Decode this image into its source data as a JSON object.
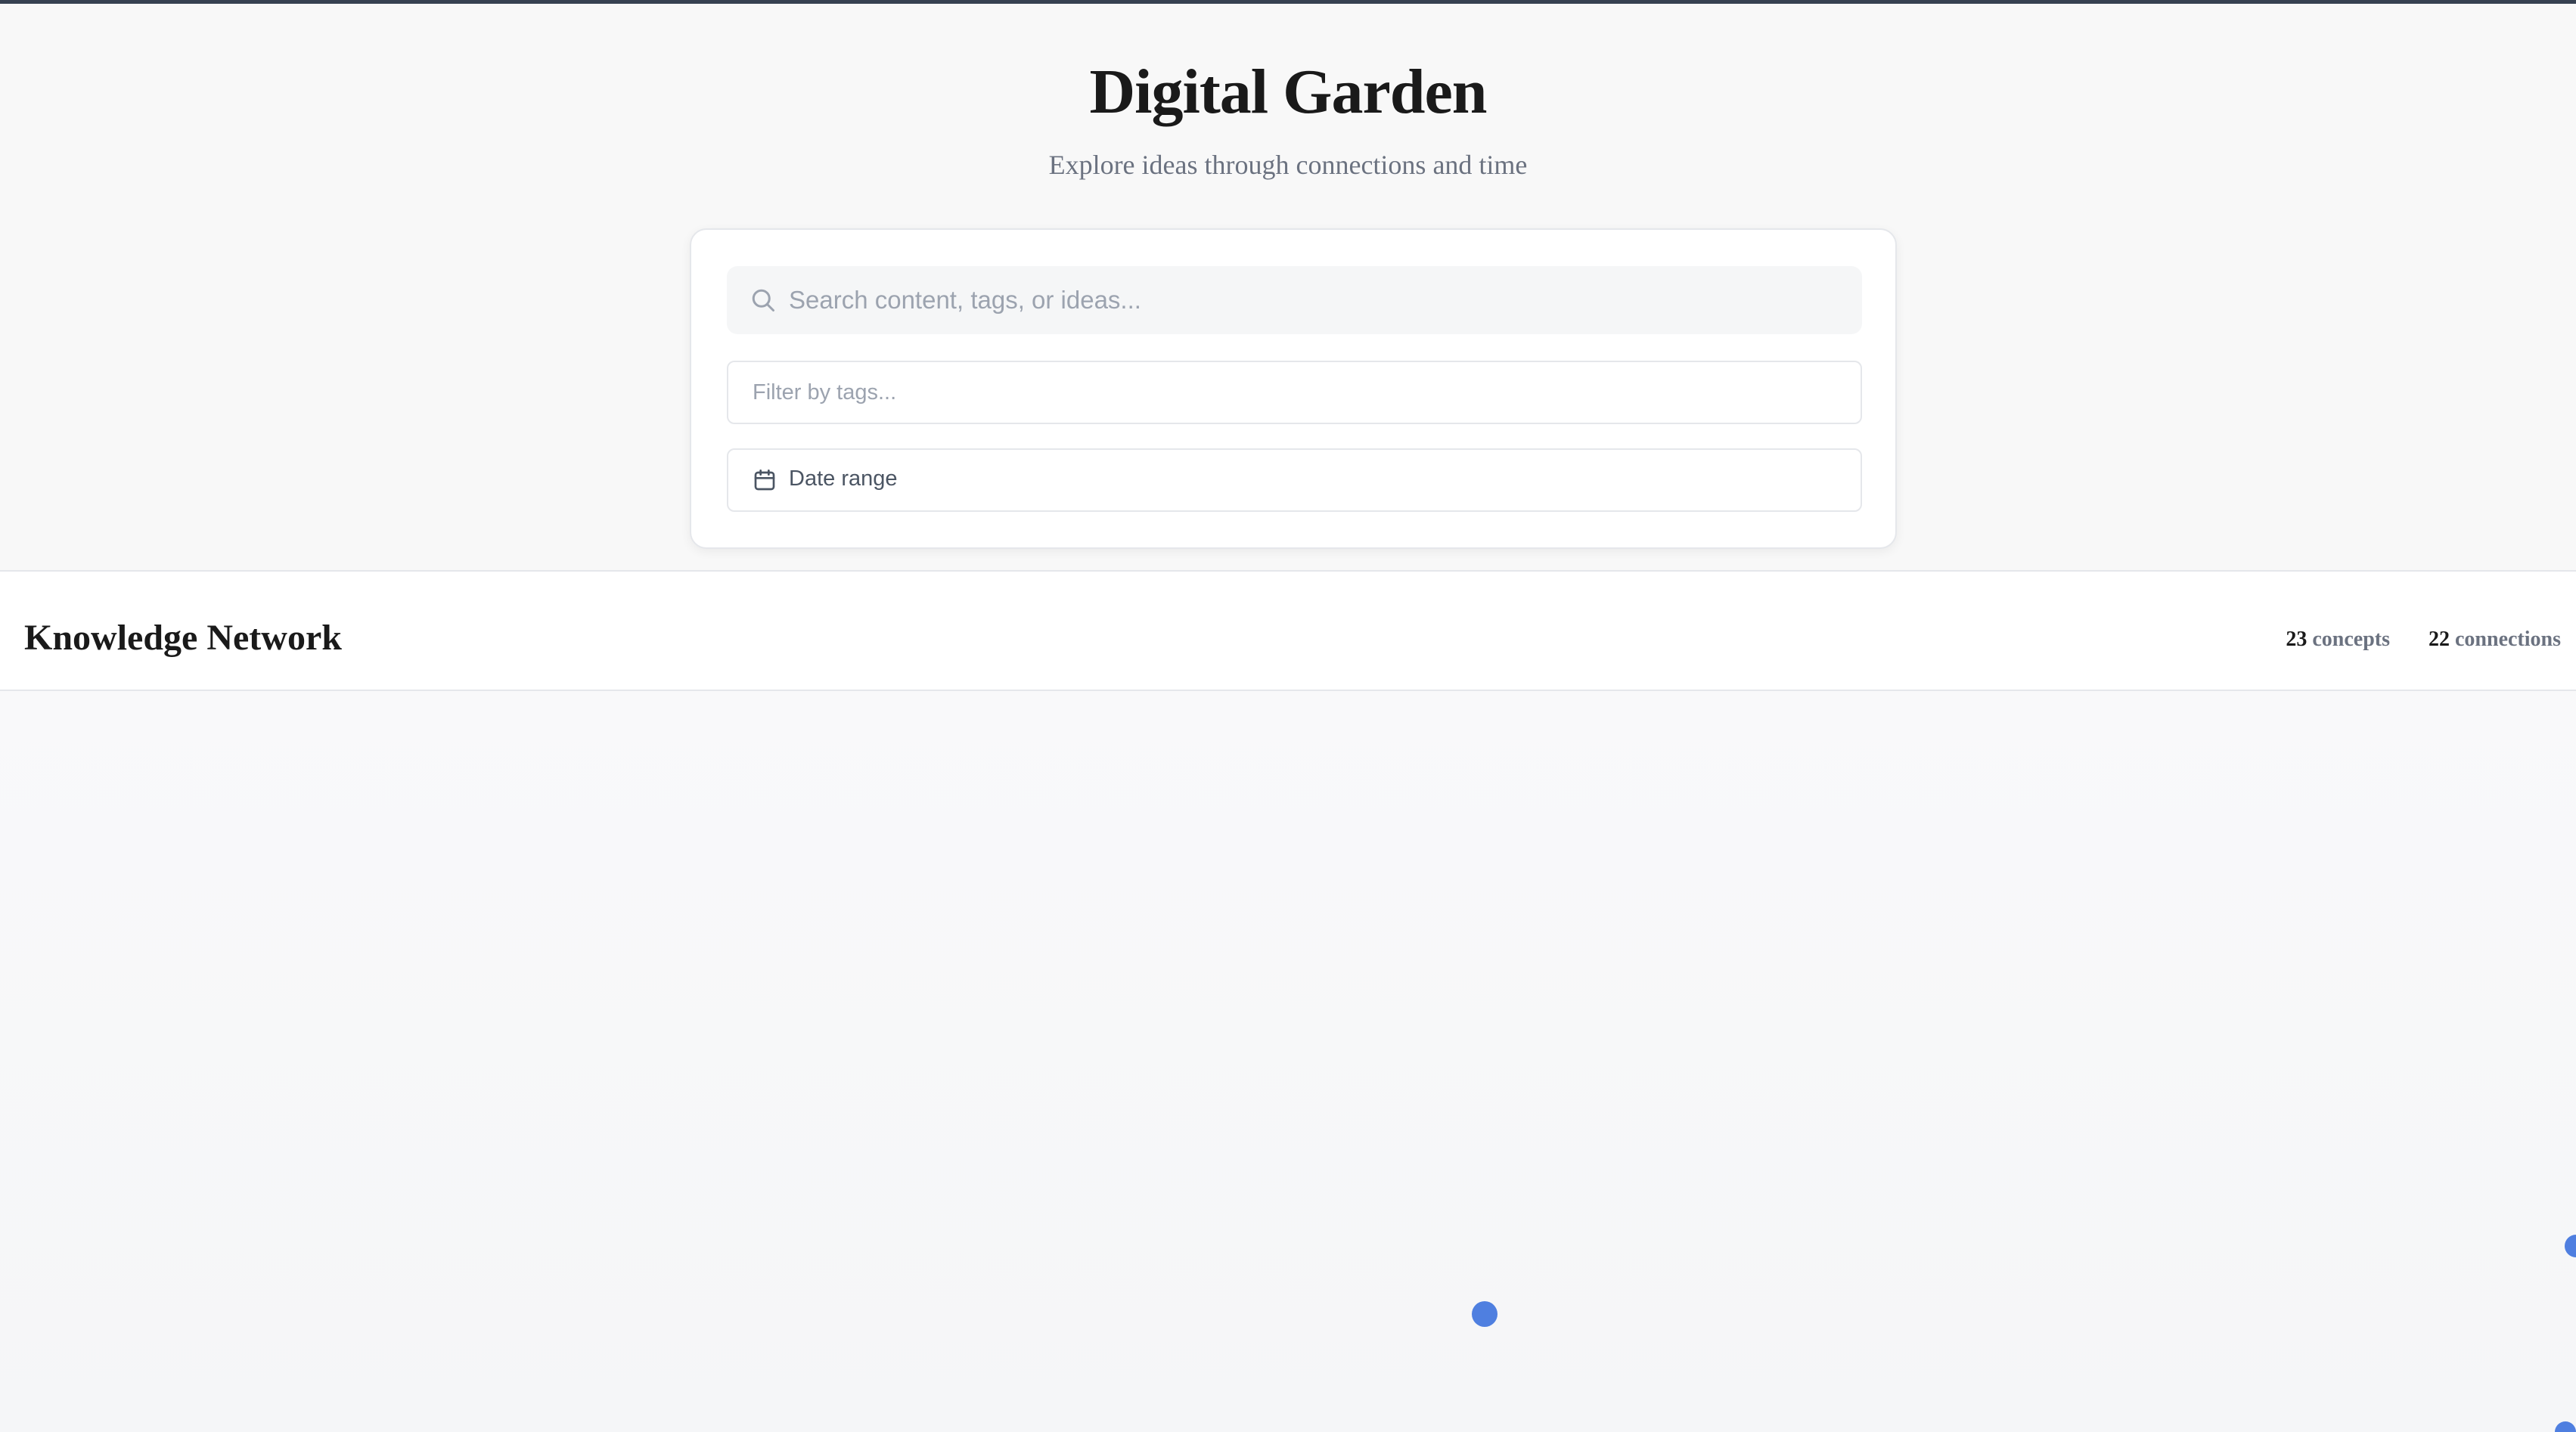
{
  "header": {
    "title": "Digital Garden",
    "subtitle": "Explore ideas through connections and time"
  },
  "filters": {
    "search_placeholder": "Search content, tags, or ideas...",
    "tags_placeholder": "Filter by tags...",
    "date_range_label": "Date range"
  },
  "network": {
    "title": "Knowledge Network",
    "concepts_count": "23",
    "concepts_label": "concepts",
    "connections_count": "22",
    "connections_label": "connections",
    "node_color": "#4f7fe0"
  },
  "icons": {
    "search": "search-icon",
    "date": "calendar-icon"
  }
}
